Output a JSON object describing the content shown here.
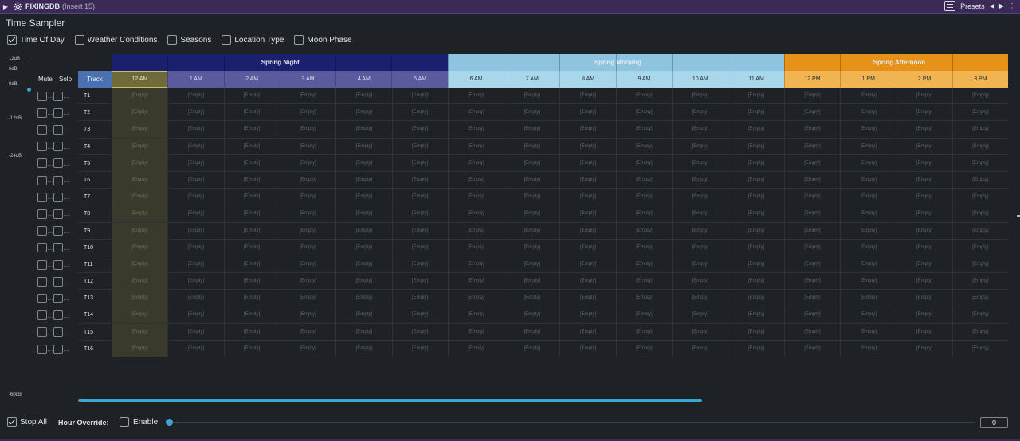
{
  "titlebar": {
    "plugin_name": "FIXINGDB",
    "insert": "(Insert 15)",
    "presets_label": "Presets"
  },
  "app": {
    "title": "Time Sampler"
  },
  "filters": [
    {
      "label": "Time Of Day",
      "checked": true
    },
    {
      "label": "Weather Conditions",
      "checked": false
    },
    {
      "label": "Seasons",
      "checked": false
    },
    {
      "label": "Location Type",
      "checked": false
    },
    {
      "label": "Moon Phase",
      "checked": false
    }
  ],
  "meter": {
    "labels": [
      "12dB",
      "6dB",
      "0dB",
      "-12dB",
      "-24dB",
      "-60dB"
    ]
  },
  "mute_solo": {
    "mute_label": "Mute",
    "solo_label": "Solo",
    "dots": "..."
  },
  "grid": {
    "track_header": "Track",
    "bands": [
      {
        "label": "Spring Night",
        "color": "#1a1f6e",
        "span": 6
      },
      {
        "label": "Spring Morning",
        "color": "#8ec4df",
        "span": 6
      },
      {
        "label": "Spring Afternoon",
        "color": "#e69118",
        "span": 4
      }
    ],
    "hours": [
      "12 AM",
      "1 AM",
      "2 AM",
      "3 AM",
      "4 AM",
      "5 AM",
      "6 AM",
      "7 AM",
      "8 AM",
      "9 AM",
      "10 AM",
      "11 AM",
      "12 PM",
      "1 PM",
      "2 PM",
      "3 PM"
    ],
    "hour_colors": [
      "#6f6a3a",
      "#5a5b9e",
      "#5a5b9e",
      "#5a5b9e",
      "#5a5b9e",
      "#5a5b9e",
      "#a8d6ea",
      "#a8d6ea",
      "#a8d6ea",
      "#a8d6ea",
      "#a8d6ea",
      "#a8d6ea",
      "#f0b552",
      "#f0b552",
      "#f0b552",
      "#f0b552"
    ],
    "selected_hour": "12 AM",
    "empty_label": "[Empty]",
    "tracks": [
      "T1",
      "T2",
      "T3",
      "T4",
      "T5",
      "T6",
      "T7",
      "T8",
      "T9",
      "T10",
      "T11",
      "T12",
      "T13",
      "T14",
      "T15",
      "T16"
    ]
  },
  "footer": {
    "stop_all_label": "Stop All",
    "stop_all_checked": true,
    "hour_override_label": "Hour Override:",
    "enable_label": "Enable",
    "enable_checked": false,
    "hour_value": "0"
  },
  "colors": {
    "accent": "#3fa6d4",
    "track_header": "#4a72b0",
    "background": "#1e2226",
    "titlebar": "#3a2a55"
  }
}
